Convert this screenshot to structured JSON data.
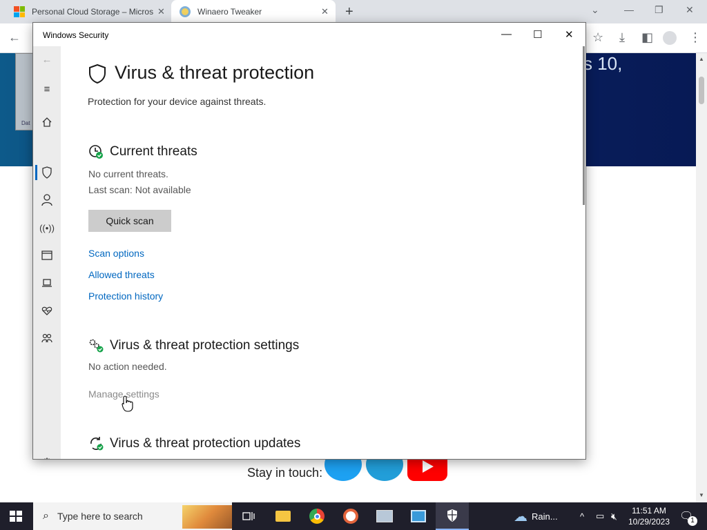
{
  "browser": {
    "tabs": [
      {
        "title": "Personal Cloud Storage – Micros",
        "active": false
      },
      {
        "title": "Winaero Tweaker",
        "active": true
      }
    ]
  },
  "webpage": {
    "banner_text": "s 10,",
    "thumb_label": "Dat",
    "stay_in_touch": "Stay in touch:"
  },
  "window": {
    "title": "Windows Security",
    "nav_items": [
      "back-arrow",
      "hamburger-menu",
      "home",
      "virus-threat-protection",
      "account-protection",
      "firewall-network",
      "app-browser-control",
      "device-security",
      "device-performance-health",
      "family-options",
      "settings"
    ]
  },
  "page": {
    "title": "Virus & threat protection",
    "subtitle": "Protection for your device against threats.",
    "current_threats": {
      "heading": "Current threats",
      "status": "No current threats.",
      "last_scan": "Last scan: Not available",
      "quick_scan": "Quick scan",
      "links": [
        "Scan options",
        "Allowed threats",
        "Protection history"
      ]
    },
    "settings": {
      "heading": "Virus & threat protection settings",
      "status": "No action needed.",
      "manage": "Manage settings"
    },
    "updates": {
      "heading": "Virus & threat protection updates"
    }
  },
  "taskbar": {
    "search_placeholder": "Type here to search",
    "weather": "Rain...",
    "time": "11:51 AM",
    "date": "10/29/2023",
    "notification_count": "1"
  },
  "colors": {
    "accent": "#0067c0",
    "ok_green": "#16a34a",
    "taskbar": "#1f1f2b",
    "banner": "#0a2060"
  }
}
